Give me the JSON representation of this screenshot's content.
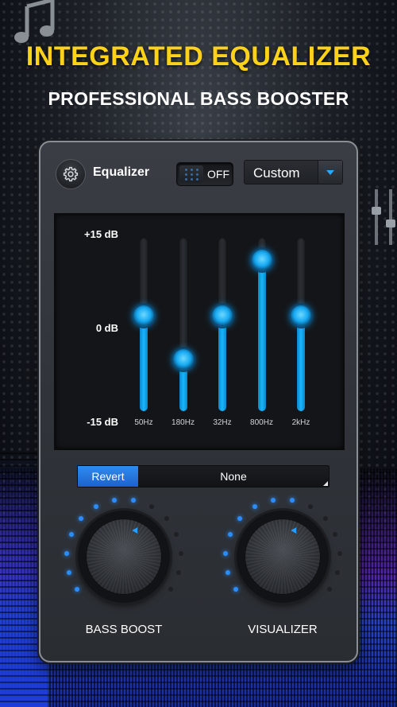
{
  "header": {
    "title": "INTEGRATED EQUALIZER",
    "subtitle": "PROFESSIONAL BASS BOOSTER"
  },
  "equalizer_panel": {
    "label": "Equalizer",
    "toggle_label": "OFF",
    "toggle_on": false,
    "preset_dropdown": "Custom",
    "db_scale": [
      "+15 dB",
      "0 dB",
      "-15 dB"
    ],
    "bands": [
      {
        "label": "50Hz",
        "level": 0.55
      },
      {
        "label": "180Hz",
        "level": 0.3
      },
      {
        "label": "32Hz",
        "level": 0.55
      },
      {
        "label": "800Hz",
        "level": 0.87
      },
      {
        "label": "2kHz",
        "level": 0.55
      }
    ],
    "revert_label": "Revert",
    "preset_name": "None"
  },
  "knobs": [
    {
      "label": "BASS BOOST",
      "lit_dots": 8,
      "total_dots": 14
    },
    {
      "label": "VISUALIZER",
      "lit_dots": 8,
      "total_dots": 14
    }
  ],
  "colors": {
    "headline": "#ffd21a",
    "accent_blue": "#19b6ff",
    "revert_button": "#2f8cf0"
  },
  "icons": [
    "music-note-icon",
    "gear-icon",
    "dropdown-arrow-icon",
    "slider-icon"
  ]
}
